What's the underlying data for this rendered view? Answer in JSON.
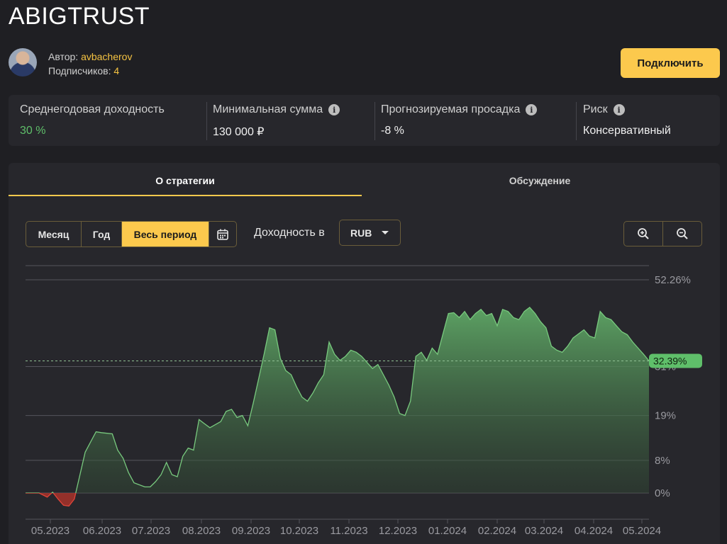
{
  "page": {
    "title": "ABIGTRUST"
  },
  "author": {
    "author_label": "Автор:",
    "author_name": "avbacherov",
    "subs_label": "Подписчиков:",
    "subs_count": "4",
    "connect_label": "Подключить"
  },
  "stats": [
    {
      "label": "Среднегодовая доходность",
      "value": "30 %",
      "info": false
    },
    {
      "label": "Минимальная сумма",
      "value": "130 000 ₽",
      "info": true
    },
    {
      "label": "Прогнозируемая просадка",
      "value": "-8 %",
      "info": true
    },
    {
      "label": "Риск",
      "value": "Консервативный",
      "info": true
    }
  ],
  "tabs": [
    {
      "label": "О стратегии",
      "active": true
    },
    {
      "label": "Обсуждение",
      "active": false
    }
  ],
  "controls": {
    "periods": [
      {
        "label": "Месяц",
        "active": false
      },
      {
        "label": "Год",
        "active": false
      },
      {
        "label": "Весь период",
        "active": true
      }
    ],
    "calendar_icon": "calendar-icon",
    "yield_label": "Доходность в",
    "currency": "RUB",
    "zoom_in_icon": "zoom-in-icon",
    "zoom_out_icon": "zoom-out-icon"
  },
  "colors": {
    "accent": "#fcc94d",
    "positive": "#5fbf6a",
    "negative": "#e0453a",
    "background": "#1f1f23",
    "panel": "#27272c"
  },
  "chart_data": {
    "type": "area",
    "x_tick_labels": [
      "05.2023",
      "06.2023",
      "07.2023",
      "08.2023",
      "09.2023",
      "10.2023",
      "11.2023",
      "12.2023",
      "01.2024",
      "02.2024",
      "03.2024",
      "04.2024",
      "05.2024"
    ],
    "y_tick_labels": [
      "52.26%",
      "31%",
      "19%",
      "8%",
      "0%"
    ],
    "current_value_label": "32.39%",
    "current_value": 32.39,
    "ylim": [
      0,
      52.26
    ],
    "grid": true,
    "series": [
      {
        "points": [
          [
            0,
            0
          ],
          [
            2.5,
            0
          ],
          [
            4,
            -1
          ],
          [
            5,
            0.2
          ],
          [
            6,
            -1.5
          ],
          [
            7,
            -3
          ],
          [
            8,
            -3.2
          ],
          [
            9,
            -1.5
          ],
          [
            11,
            10
          ],
          [
            12,
            12.5
          ],
          [
            13,
            15
          ],
          [
            14,
            14.8
          ],
          [
            16,
            14.5
          ],
          [
            17,
            10.5
          ],
          [
            18,
            8.5
          ],
          [
            19,
            5
          ],
          [
            20,
            2.5
          ],
          [
            22,
            1.5
          ],
          [
            23,
            1.5
          ],
          [
            24,
            2.8
          ],
          [
            25,
            4.5
          ],
          [
            26,
            7.5
          ],
          [
            27,
            4.5
          ],
          [
            28,
            4
          ],
          [
            29,
            9
          ],
          [
            30,
            11
          ],
          [
            31,
            10.5
          ],
          [
            32,
            18
          ],
          [
            33,
            17
          ],
          [
            34,
            16
          ],
          [
            36,
            17.5
          ],
          [
            37,
            20
          ],
          [
            38,
            20.5
          ],
          [
            39,
            18.5
          ],
          [
            40,
            19
          ],
          [
            41,
            16.5
          ],
          [
            42,
            22
          ],
          [
            43,
            28
          ],
          [
            44,
            34
          ],
          [
            45,
            40.5
          ],
          [
            46,
            40
          ],
          [
            47,
            33
          ],
          [
            48,
            30
          ],
          [
            49,
            29
          ],
          [
            50,
            26
          ],
          [
            51,
            23.5
          ],
          [
            52,
            22.5
          ],
          [
            53,
            24.5
          ],
          [
            54,
            27
          ],
          [
            55,
            29
          ],
          [
            56,
            37
          ],
          [
            57,
            34
          ],
          [
            58,
            32.5
          ],
          [
            59,
            33.5
          ],
          [
            60,
            35
          ],
          [
            61,
            34.5
          ],
          [
            62,
            33.5
          ],
          [
            63,
            32
          ],
          [
            64,
            30.5
          ],
          [
            65,
            31.5
          ],
          [
            66,
            29
          ],
          [
            67,
            26.5
          ],
          [
            68,
            23.5
          ],
          [
            69,
            19.5
          ],
          [
            70,
            19
          ],
          [
            71,
            22.5
          ],
          [
            72,
            33.5
          ],
          [
            73,
            34.5
          ],
          [
            74,
            32.5
          ],
          [
            75,
            35.5
          ],
          [
            76,
            34
          ],
          [
            77,
            39
          ],
          [
            78,
            44
          ],
          [
            79,
            44.2
          ],
          [
            80,
            43
          ],
          [
            81,
            44.5
          ],
          [
            82,
            42.5
          ],
          [
            83,
            44
          ],
          [
            84,
            45
          ],
          [
            85,
            43.5
          ],
          [
            86,
            44
          ],
          [
            87,
            41
          ],
          [
            88,
            45
          ],
          [
            89,
            44.5
          ],
          [
            90,
            43
          ],
          [
            91,
            42.5
          ],
          [
            92,
            44.5
          ],
          [
            93,
            45.5
          ],
          [
            94,
            44
          ],
          [
            95,
            42
          ],
          [
            96,
            40.5
          ],
          [
            97,
            36
          ],
          [
            98,
            35
          ],
          [
            99,
            34.5
          ],
          [
            100,
            36
          ],
          [
            101,
            38
          ],
          [
            102,
            39
          ],
          [
            103,
            40
          ],
          [
            104,
            38.5
          ],
          [
            105,
            38
          ],
          [
            106,
            44.5
          ],
          [
            107,
            43
          ],
          [
            108,
            42.5
          ],
          [
            109,
            41
          ],
          [
            110,
            39.5
          ],
          [
            111,
            38.8
          ],
          [
            112,
            37
          ],
          [
            113,
            35.5
          ],
          [
            114,
            34
          ],
          [
            115,
            32.39
          ]
        ]
      }
    ]
  }
}
